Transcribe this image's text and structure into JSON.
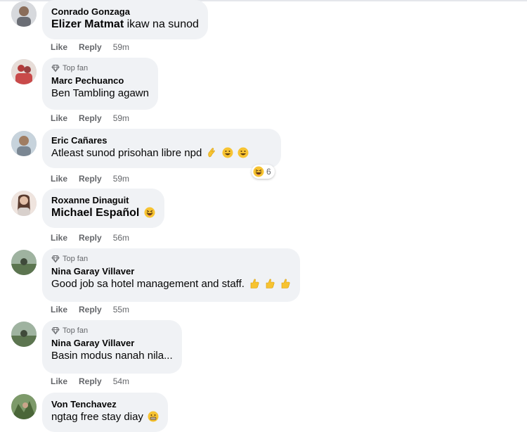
{
  "comments": [
    {
      "author": "Conrado Gonzaga",
      "mention": "Elizer Matmat",
      "text": "ikaw na sunod",
      "like_label": "Like",
      "reply_label": "Reply",
      "time": "59m",
      "avatar_color": "#7d7f85"
    },
    {
      "badge": "Top fan",
      "author": "Marc Pechuanco",
      "text": "Ben Tambling agawn",
      "like_label": "Like",
      "reply_label": "Reply",
      "time": "59m",
      "avatar_color": "#b9a9a2"
    },
    {
      "author": "Eric Cañares",
      "text": "Atleast sunod prisohan libre npd",
      "emojis": [
        "crossed-fingers-icon",
        "grinning-face-icon",
        "grinning-face-icon"
      ],
      "reaction_count": "6",
      "like_label": "Like",
      "reply_label": "Reply",
      "time": "59m",
      "avatar_color": "#8a9aa8"
    },
    {
      "author": "Roxanne Dinaguit",
      "mention": "Michael Español",
      "emojis": [
        "laughing-tongue-face-icon"
      ],
      "like_label": "Like",
      "reply_label": "Reply",
      "time": "56m",
      "avatar_color": "#c9b2a6"
    },
    {
      "badge": "Top fan",
      "author": "Nina Garay Villaver",
      "text": "Good job sa hotel management and staff.",
      "emojis": [
        "thumbs-up-icon",
        "thumbs-up-icon",
        "thumbs-up-icon"
      ],
      "like_label": "Like",
      "reply_label": "Reply",
      "time": "55m",
      "avatar_color": "#6f8a6a"
    },
    {
      "badge": "Top fan",
      "author": "Nina Garay Villaver",
      "text": "Basin modus nanah nila...",
      "like_label": "Like",
      "reply_label": "Reply",
      "time": "54m",
      "avatar_color": "#6f8a6a"
    },
    {
      "author": "Von Tenchavez",
      "text": "ngtag free stay diay",
      "emojis": [
        "grimacing-face-icon"
      ],
      "avatar_color": "#5e7a4e"
    }
  ],
  "colors": {
    "bubble": "#f0f2f5",
    "secondary_text": "#65676b",
    "emoji_yellow": "#f7c331"
  }
}
